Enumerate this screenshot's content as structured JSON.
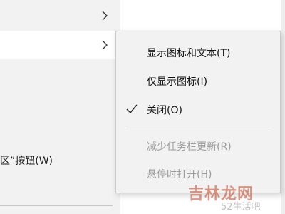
{
  "parent_menu": {
    "items": [
      {
        "label": "",
        "icon": "chevron-right-icon",
        "highlighted": false
      },
      {
        "label": "",
        "icon": "chevron-right-icon",
        "highlighted": true
      },
      {
        "label": "区”按钮(W)",
        "icon": "",
        "highlighted": false
      }
    ]
  },
  "submenu": {
    "items": [
      {
        "label": "显示图标和文本(T)",
        "checked": false,
        "enabled": true
      },
      {
        "label": "仅显示图标(I)",
        "checked": false,
        "enabled": true
      },
      {
        "label": "关闭(O)",
        "checked": true,
        "enabled": true
      },
      {
        "label": "减少任务栏更新(R)",
        "checked": false,
        "enabled": false
      },
      {
        "label": "悬停时打开(H)",
        "checked": false,
        "enabled": false
      }
    ]
  },
  "watermark": {
    "text": "吉林龙网",
    "subtext": "52生活吧"
  }
}
